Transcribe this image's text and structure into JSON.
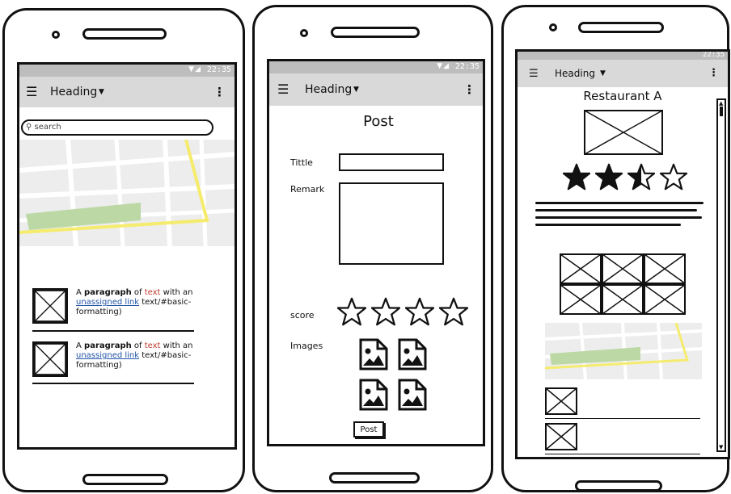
{
  "status": {
    "time": "22:35"
  },
  "phone1": {
    "heading": "Heading",
    "search_placeholder": "search",
    "items": [
      {
        "bold": "paragraph",
        "link": "unassigned link",
        "lead": "A ",
        "mid": " of ",
        "red": "text",
        "tail1": " with an",
        "tail2": " text/#basic-",
        "tail3": "formatting)"
      },
      {
        "bold": "paragraph",
        "link": "unassigned link",
        "lead": "A ",
        "mid": " of ",
        "red": "text",
        "tail1": " with an",
        "tail2": " text/#basic-",
        "tail3": "formatting)"
      }
    ]
  },
  "phone2": {
    "heading": "Heading",
    "title": "Post",
    "title_label": "Tittle",
    "remark_label": "Remark",
    "score_label": "score",
    "images_label": "Images",
    "post_button": "Post",
    "score": 0,
    "score_max": 4
  },
  "phone3": {
    "heading": "Heading",
    "restaurant_name": "Restaurant A",
    "rating": 2.5,
    "rating_max": 4
  },
  "colors": {
    "map_road": "#ffffff",
    "map_bg": "#ededed",
    "map_park": "#bcd8a5",
    "map_highway": "#f5ec6d",
    "statusbar": "#bdbdbd",
    "appbar": "#d9d9d9",
    "link": "#2155a6",
    "red_text": "#c0392b"
  }
}
